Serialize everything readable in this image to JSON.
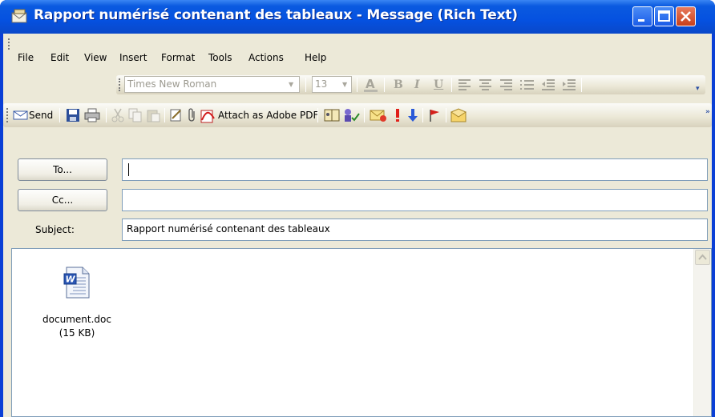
{
  "window": {
    "title": "Rapport numérisé contenant des tableaux - Message (Rich Text)"
  },
  "menu": [
    {
      "label": "File"
    },
    {
      "label": "Edit"
    },
    {
      "label": "View"
    },
    {
      "label": "Insert"
    },
    {
      "label": "Format"
    },
    {
      "label": "Tools"
    },
    {
      "label": "Actions"
    },
    {
      "label": "Help"
    }
  ],
  "formatting": {
    "font": "Times New Roman",
    "size": "13",
    "icons": [
      "font-color-icon",
      "bold-icon",
      "italic-icon",
      "underline-icon",
      "align-left-icon",
      "center-icon",
      "align-right-icon",
      "bullets-icon",
      "decrease-indent-icon",
      "increase-indent-icon"
    ]
  },
  "standard_toolbar": {
    "send": "Send",
    "attach_pdf": "Attach as Adobe PDF",
    "icons": [
      "save-icon",
      "print-icon",
      "cut-icon",
      "copy-icon",
      "paste-icon",
      "insert-file-icon",
      "paperclip-icon",
      "address-book-icon",
      "check-names-icon",
      "options-icon",
      "high-importance-icon",
      "low-importance-icon",
      "follow-up-flag-icon",
      "envelope-icon"
    ]
  },
  "header": {
    "to_button": "To...",
    "cc_button": "Cc...",
    "subject_label": "Subject:",
    "to_value": "",
    "cc_value": "",
    "subject_value": "Rapport numérisé contenant des tableaux"
  },
  "attachment": {
    "name": "document.doc",
    "size": "(15 KB)"
  },
  "colors": {
    "titlebar": "#0551e0",
    "face": "#ece9d8",
    "field_border": "#7f9db9"
  }
}
